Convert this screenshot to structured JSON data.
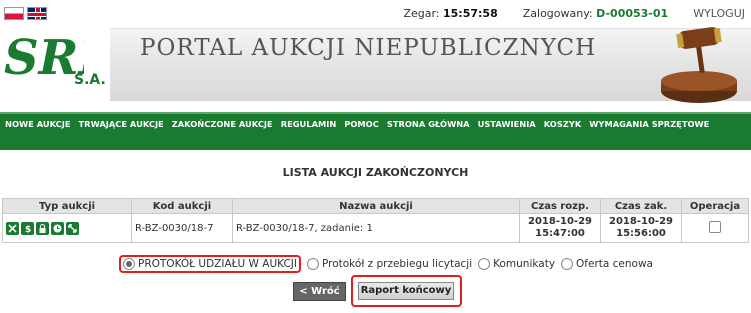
{
  "top": {
    "clock_label": "Zegar:",
    "clock_value": "15:57:58",
    "user_label": "Zalogowany:",
    "user_value": "D-00053-01",
    "logout": "WYLOGUJ"
  },
  "logo": {
    "letters": "SRK",
    "sub": "S.A."
  },
  "banner": {
    "title": "PORTAL AUKCJI NIEPUBLICZNYCH"
  },
  "nav": {
    "items": [
      "NOWE AUKCJE",
      "TRWAJĄCE AUKCJE",
      "ZAKOŃCZONE AUKCJE",
      "REGULAMIN",
      "POMOC",
      "STRONA GŁÓWNA",
      "USTAWIENIA",
      "KOSZYK",
      "WYMAGANIA SPRZĘTOWE"
    ]
  },
  "main": {
    "title": "LISTA AUKCJI ZAKOŃCZONYCH",
    "table": {
      "headers": [
        "Typ aukcji",
        "Kod aukcji",
        "Nazwa aukcji",
        "Czas rozp.",
        "Czas zak.",
        "Operacja"
      ],
      "rows": [
        {
          "code": "R-BZ-0030/18-7",
          "name": "R-BZ-0030/18-7, zadanie: 1",
          "start_date": "2018-10-29",
          "start_time": "15:47:00",
          "end_date": "2018-10-29",
          "end_time": "15:56:00"
        }
      ],
      "type_icons": [
        "cancel-icon",
        "dollar-icon",
        "lock-icon",
        "clock-icon",
        "arrows-icon"
      ]
    },
    "options": [
      {
        "label": "PROTOKÓŁ UDZIAŁU W AUKCJI",
        "selected": true
      },
      {
        "label": "Protokół z przebiegu licytacji",
        "selected": false
      },
      {
        "label": "Komunikaty",
        "selected": false
      },
      {
        "label": "Oferta cenowa",
        "selected": false
      }
    ],
    "back_button": "< Wróć",
    "report_button": "Raport końcowy"
  },
  "colors": {
    "brand": "#1a7a30",
    "end_time": "#e07020",
    "highlight": "#e02020"
  }
}
